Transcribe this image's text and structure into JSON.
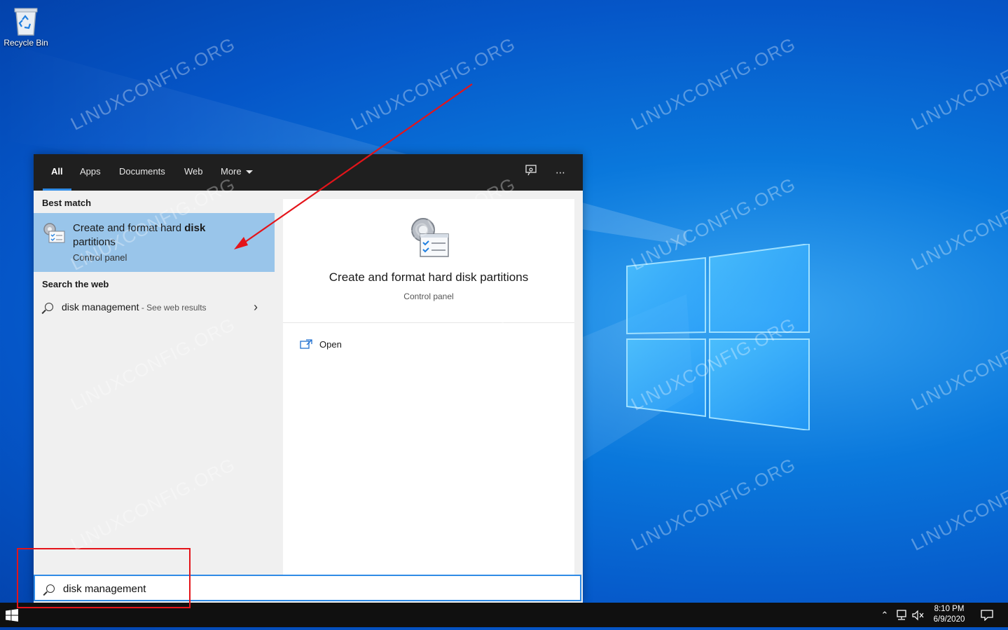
{
  "desktop": {
    "recycle_bin_label": "Recycle Bin",
    "watermark_text": "LINUXCONFIG.ORG"
  },
  "search_panel": {
    "tabs": [
      {
        "label": "All",
        "active": true
      },
      {
        "label": "Apps",
        "active": false
      },
      {
        "label": "Documents",
        "active": false
      },
      {
        "label": "Web",
        "active": false
      },
      {
        "label": "More",
        "active": false
      }
    ],
    "header_icons": [
      "feedback-icon",
      "more-options-icon"
    ],
    "best_match": {
      "section_label": "Best match",
      "title_plain": "Create and format hard ",
      "title_bold": "disk",
      "title_rest": "partitions",
      "subtitle": "Control panel",
      "icon": "control-panel-disk-icon"
    },
    "web_search": {
      "section_label": "Search the web",
      "query": "disk management",
      "suffix": " - See web results"
    },
    "preview": {
      "title": "Create and format hard disk partitions",
      "subtitle": "Control panel",
      "actions": [
        {
          "label": "Open",
          "icon": "open-window-icon"
        }
      ]
    },
    "search_box": {
      "value": "disk management",
      "icon": "search-icon"
    }
  },
  "taskbar": {
    "time": "8:10 PM",
    "date": "6/9/2020",
    "tray_icons": [
      "chevron-up-icon",
      "network-icon",
      "volume-muted-icon"
    ],
    "notification_icon": "action-center-icon"
  },
  "colors": {
    "accent": "#2f8be6",
    "best_match_bg": "#99c5ea",
    "annotation_red": "#e4141a",
    "taskbar_bg": "#101010"
  }
}
